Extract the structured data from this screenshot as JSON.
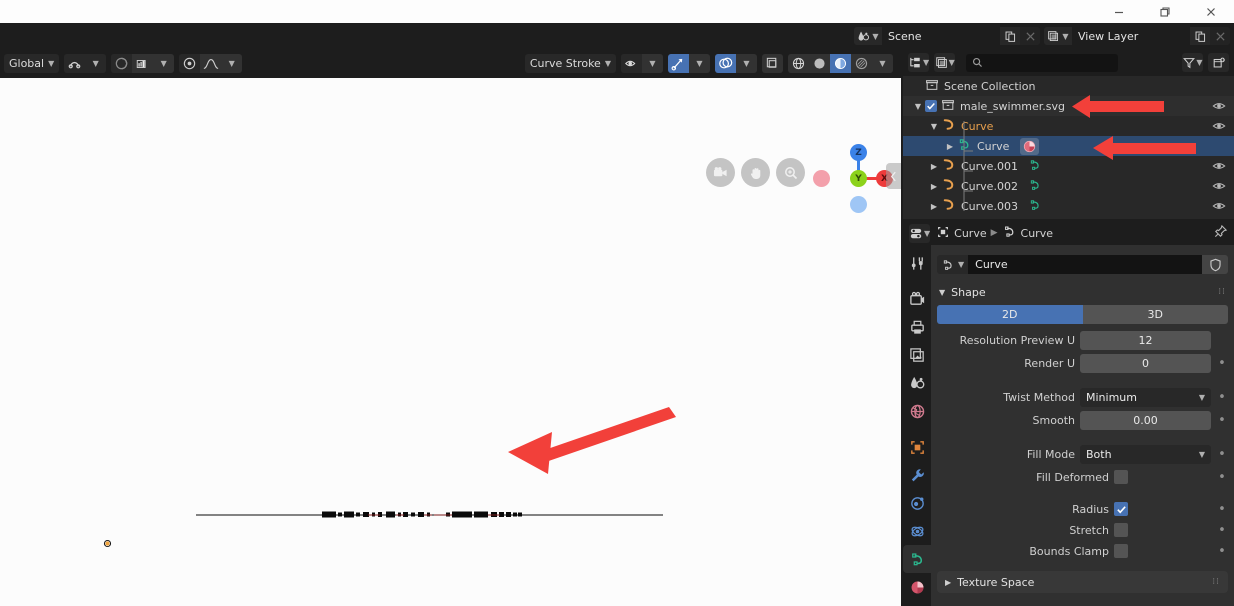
{
  "window": {
    "controls": [
      {
        "name": "minimize",
        "glyph": "minimize-icon"
      },
      {
        "name": "maximize",
        "glyph": "maximize-icon"
      },
      {
        "name": "close",
        "glyph": "close-icon"
      }
    ]
  },
  "topbar": {
    "scene": {
      "label": "Scene",
      "icon": "scene-icon",
      "new_icon": "duplicate-icon",
      "unlink_icon": "x-icon"
    },
    "view_layer": {
      "label": "View Layer",
      "icon": "view-layer-icon",
      "new_icon": "duplicate-icon",
      "unlink_icon": "x-icon"
    }
  },
  "viewport": {
    "header": {
      "mode": "Global",
      "mode_label": "Global",
      "transform_orientation": "Global",
      "tool_label": "Curve Stroke",
      "icons": [
        "snap-magnet-icon",
        "proportional-edit-icon",
        "proportional-falloff-icon",
        "visibility-icon",
        "gizmo-icon",
        "overlays-icon",
        "xray-icon",
        "shading-wireframe-icon",
        "shading-solid-icon",
        "shading-material-icon",
        "shading-rendered-icon"
      ]
    },
    "nav_buttons": [
      "camera-icon",
      "hand-icon",
      "zoom-icon"
    ],
    "gizmo": {
      "axes": [
        {
          "label": "Z",
          "color": "#3b82e8"
        },
        {
          "label": "Y",
          "color": "#8cd21b"
        },
        {
          "label": "X",
          "color": "#ee3b3b"
        }
      ],
      "negative": [
        {
          "label": "-X",
          "color": "#f3a0ab"
        },
        {
          "label": "-Z",
          "color": "#9fc6f5"
        }
      ]
    },
    "sidebar_tab": "chevron-left-icon"
  },
  "outliner": {
    "header": {
      "display_mode": "view-layer-icon",
      "filter_icon": "filter-icon",
      "new_collection_icon": "new-collection-icon",
      "search_placeholder": "",
      "search_value": ""
    },
    "rows": [
      {
        "label": "Scene Collection",
        "icon": "collection-icon",
        "indent": 0,
        "expander": "",
        "checkbox": false,
        "eye": false,
        "selected": false,
        "color": "normal"
      },
      {
        "label": "male_swimmer.svg",
        "icon": "collection-icon",
        "indent": 1,
        "expander": "down",
        "checkbox": true,
        "eye": true,
        "selected": false,
        "color": "normal"
      },
      {
        "label": "Curve",
        "icon": "curve-object-icon",
        "indent": 2,
        "expander": "down",
        "checkbox": false,
        "eye": true,
        "selected": false,
        "color": "orange"
      },
      {
        "label": "Curve",
        "icon": "curve-data-icon",
        "indent": 3,
        "expander": "right",
        "checkbox": false,
        "eye": false,
        "selected": true,
        "color": "normal",
        "extra_icon": "material-icon"
      },
      {
        "label": "Curve.001",
        "icon": "curve-object-icon",
        "indent": 2,
        "expander": "right",
        "checkbox": false,
        "eye": true,
        "selected": false,
        "color": "normal",
        "extra_icon": "curve-data-icon"
      },
      {
        "label": "Curve.002",
        "icon": "curve-object-icon",
        "indent": 2,
        "expander": "right",
        "checkbox": false,
        "eye": true,
        "selected": false,
        "color": "normal",
        "extra_icon": "curve-data-icon"
      },
      {
        "label": "Curve.003",
        "icon": "curve-object-icon",
        "indent": 2,
        "expander": "right",
        "checkbox": false,
        "eye": true,
        "selected": false,
        "color": "normal",
        "extra_icon": "curve-data-icon"
      }
    ]
  },
  "properties": {
    "breadcrumb": [
      {
        "label": "Curve",
        "icon": "object-icon"
      },
      {
        "label": "Curve",
        "icon": "curve-data-icon"
      }
    ],
    "pin_icon": "pin-icon",
    "datablock": {
      "name": "Curve",
      "icon": "curve-data-icon",
      "shield_icon": "fake-user-icon"
    },
    "tabs": [
      {
        "name": "tool",
        "icon": "tool-icon",
        "active": false
      },
      {
        "name": "render",
        "icon": "render-icon",
        "active": false
      },
      {
        "name": "output",
        "icon": "output-icon",
        "active": false
      },
      {
        "name": "view-layer",
        "icon": "view-layer-icon",
        "active": false
      },
      {
        "name": "scene",
        "icon": "scene-icon",
        "active": false
      },
      {
        "name": "world",
        "icon": "world-icon",
        "active": false
      },
      {
        "name": "object",
        "icon": "object-icon",
        "active": false
      },
      {
        "name": "modifiers",
        "icon": "wrench-icon",
        "active": false
      },
      {
        "name": "particles",
        "icon": "particles-icon",
        "active": false
      },
      {
        "name": "physics",
        "icon": "physics-icon",
        "active": false
      },
      {
        "name": "object-data",
        "icon": "curve-data-icon",
        "active": true
      },
      {
        "name": "material",
        "icon": "material-icon",
        "active": false
      }
    ],
    "shape_panel": {
      "title": "Shape",
      "expanded": true,
      "dimension": {
        "options": [
          "2D",
          "3D"
        ],
        "selected": "2D"
      },
      "fields": [
        {
          "label": "Resolution Preview U",
          "value": "12",
          "type": "number",
          "animatable": false
        },
        {
          "label": "Render U",
          "value": "0",
          "type": "number",
          "animatable": true
        },
        {
          "label": "Twist Method",
          "value": "Minimum",
          "type": "dropdown",
          "animatable": true
        },
        {
          "label": "Smooth",
          "value": "0.00",
          "type": "number",
          "animatable": true
        },
        {
          "label": "Fill Mode",
          "value": "Both",
          "type": "dropdown",
          "animatable": true
        }
      ],
      "checkboxes": [
        {
          "label": "Fill Deformed",
          "checked": false,
          "animatable": true
        },
        {
          "label": "Radius",
          "checked": true,
          "animatable": true
        },
        {
          "label": "Stretch",
          "checked": false,
          "animatable": true
        },
        {
          "label": "Bounds Clamp",
          "checked": false,
          "animatable": true
        }
      ]
    },
    "texture_space_panel": {
      "title": "Texture Space",
      "expanded": false
    }
  },
  "annotations": {
    "arrow_color": "#f2403a",
    "arrows": [
      {
        "name": "arrow-to-collection",
        "target": "male_swimmer.svg"
      },
      {
        "name": "arrow-to-material-icon",
        "target": "Curve material icon"
      },
      {
        "name": "arrow-to-curve-geometry",
        "target": "flattened curve in viewport"
      }
    ]
  }
}
